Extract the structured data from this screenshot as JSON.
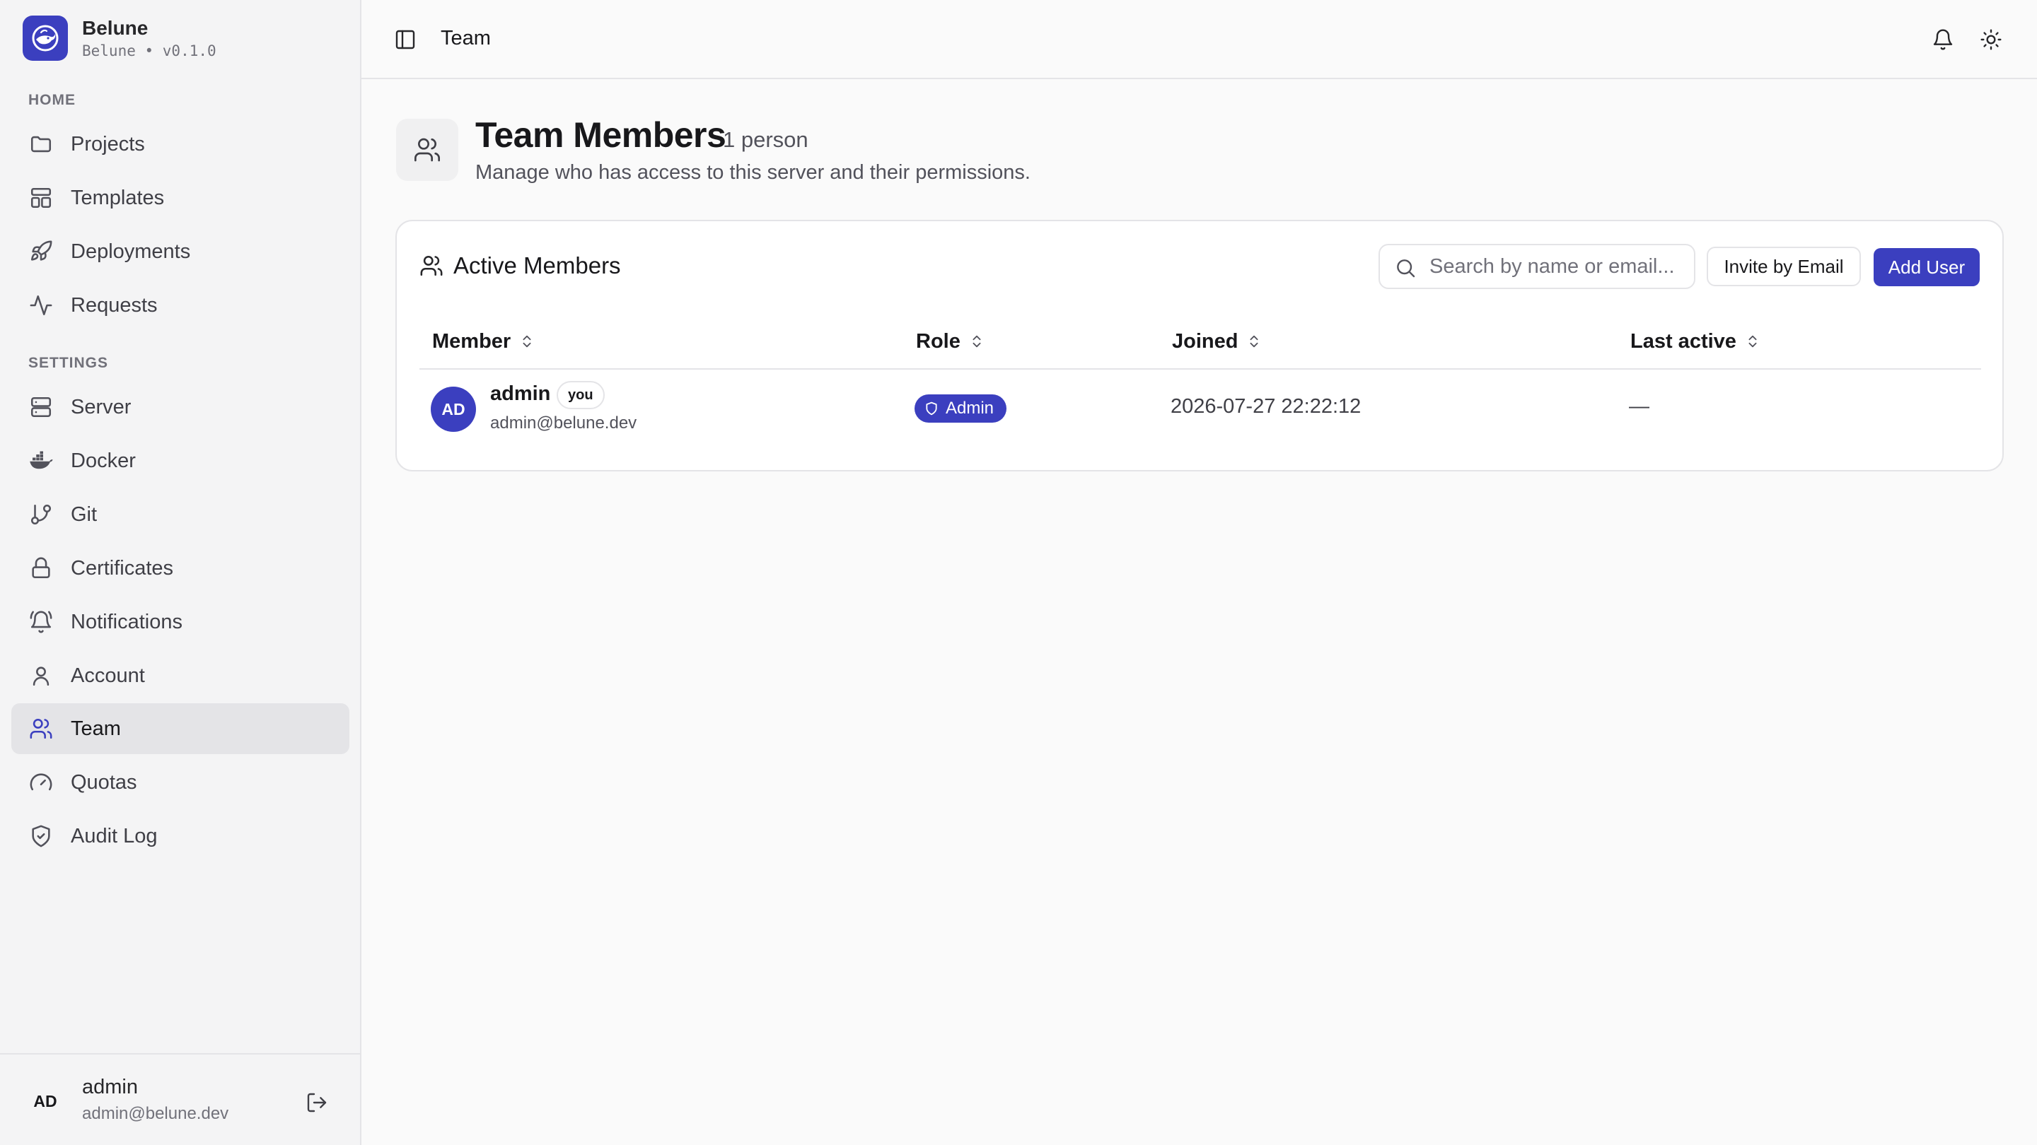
{
  "brand": {
    "name": "Belune",
    "version": "Belune • v0.1.0",
    "logo_icon": "whale-logo-icon",
    "accent_color": "#3b3fbf"
  },
  "sidebar": {
    "sections": [
      {
        "label": "HOME",
        "items": [
          {
            "label": "Projects",
            "icon": "folder-icon"
          },
          {
            "label": "Templates",
            "icon": "layout-icon"
          },
          {
            "label": "Deployments",
            "icon": "rocket-icon"
          },
          {
            "label": "Requests",
            "icon": "activity-icon"
          }
        ]
      },
      {
        "label": "SETTINGS",
        "items": [
          {
            "label": "Server",
            "icon": "server-icon"
          },
          {
            "label": "Docker",
            "icon": "docker-icon"
          },
          {
            "label": "Git",
            "icon": "git-branch-icon"
          },
          {
            "label": "Certificates",
            "icon": "lock-icon"
          },
          {
            "label": "Notifications",
            "icon": "bell-ring-icon"
          },
          {
            "label": "Account",
            "icon": "user-icon"
          },
          {
            "label": "Team",
            "icon": "users-icon",
            "active": true
          },
          {
            "label": "Quotas",
            "icon": "gauge-icon"
          },
          {
            "label": "Audit Log",
            "icon": "shield-check-icon"
          }
        ]
      }
    ],
    "footer": {
      "initials": "AD",
      "name": "admin",
      "email": "admin@belune.dev",
      "logout_icon": "log-out-icon"
    }
  },
  "topbar": {
    "breadcrumb": "Team",
    "icons": [
      "panel-left-icon",
      "bell-icon",
      "sun-icon"
    ]
  },
  "page": {
    "title": "Team Members",
    "count": "1 person",
    "subtitle": "Manage who has access to this server and their permissions."
  },
  "members_card": {
    "title": "Active Members",
    "search_placeholder": "Search by name or email...",
    "invite_label": "Invite by Email",
    "add_label": "Add User",
    "columns": [
      "Member",
      "Role",
      "Joined",
      "Last active"
    ],
    "rows": [
      {
        "initials": "AD",
        "name": "admin",
        "badge": "you",
        "email": "admin@belune.dev",
        "role": "Admin",
        "joined": "2026-07-27 22:22:12",
        "last_active": "—"
      }
    ]
  }
}
